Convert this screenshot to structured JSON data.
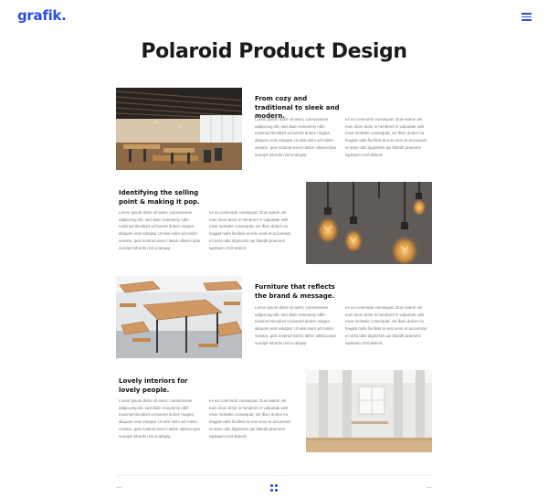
{
  "brand": {
    "logo": "grafik."
  },
  "header": {
    "menu_icon": "hamburger-icon"
  },
  "page": {
    "title": "Polaroid Product Design"
  },
  "colors": {
    "accent": "#2b4fe0",
    "text": "#111111",
    "muted": "#777777"
  },
  "sections": [
    {
      "heading": "From cozy and traditional to sleek and modern.",
      "image": "restaurant-interior",
      "col1": "Lorem ipsum dolor sit amet, consectetuer adipiscing elit, sed diam nonummy nibh euismod tincidunt ut laoreet dolore magna aliquam erat volutpat. Ut wisi enim ad minim veniam, quis nostrud exerci tation ullamcorper suscipit lobortis nisl ut aliquip",
      "col2": "ex ea commodo consequat. Duis autem vel eum iriure dolor in hendrerit in vulputate velit esse molestie consequat, vel illum dolore eu feugiat nulla facilisis at vero eros et accumsan et iusto odio dignissim qui blandit praesent luptatum zzril delenit."
    },
    {
      "heading": "Identifying the selling point & making it pop.",
      "image": "hanging-light-bulbs",
      "col1": "Lorem ipsum dolor sit amet, consectetuer adipiscing elit, sed diam nonummy nibh euismod tincidunt ut laoreet dolore magna aliquam erat volutpat. Ut wisi enim ad minim veniam, quis nostrud exerci tation ullamcorper suscipit lobortis nisl ut aliquip",
      "col2": "ex ea commodo consequat. Duis autem vel eum iriure dolor in hendrerit in vulputate velit esse molestie consequat, vel illum dolore eu feugiat nulla facilisis at vero eros et accumsan et iusto odio dignissim qui blandit praesent luptatum zzril delenit."
    },
    {
      "heading": "Furniture that reflects the brand & message.",
      "image": "wooden-tables-and-chairs",
      "col1": "Lorem ipsum dolor sit amet, consectetuer adipiscing elit, sed diam nonummy nibh euismod tincidunt ut laoreet dolore magna aliquam erat volutpat. Ut wisi enim ad minim veniam, quis nostrud exerci tation ullamcorper suscipit lobortis nisl ut aliquip",
      "col2": "ex ea commodo consequat. Duis autem vel eum iriure dolor in hendrerit in vulputate velit esse molestie consequat, vel illum dolore eu feugiat nulla facilisis at vero eros et accumsan et iusto odio dignissim qui blandit praesent luptatum zzril delenit."
    },
    {
      "heading": "Lovely interiors for lovely people.",
      "image": "bright-hall-interior",
      "col1": "Lorem ipsum dolor sit amet, consectetuer adipiscing elit, sed diam nonummy nibh euismod tincidunt ut laoreet dolore magna aliquam erat volutpat. Ut wisi enim ad minim veniam, quis nostrud exerci tation ullamcorper suscipit lobortis nisl ut aliquip",
      "col2": "ex ea commodo consequat. Duis autem vel eum iriure dolor in hendrerit in vulputate velit esse molestie consequat, vel illum dolore eu feugiat nulla facilisis at vero eros et accumsan et iusto odio dignissim qui blandit praesent luptatum zzril delenit."
    }
  ],
  "pagination": {
    "prev_label": "←",
    "next_label": "→",
    "grid_icon": "grid-icon"
  }
}
